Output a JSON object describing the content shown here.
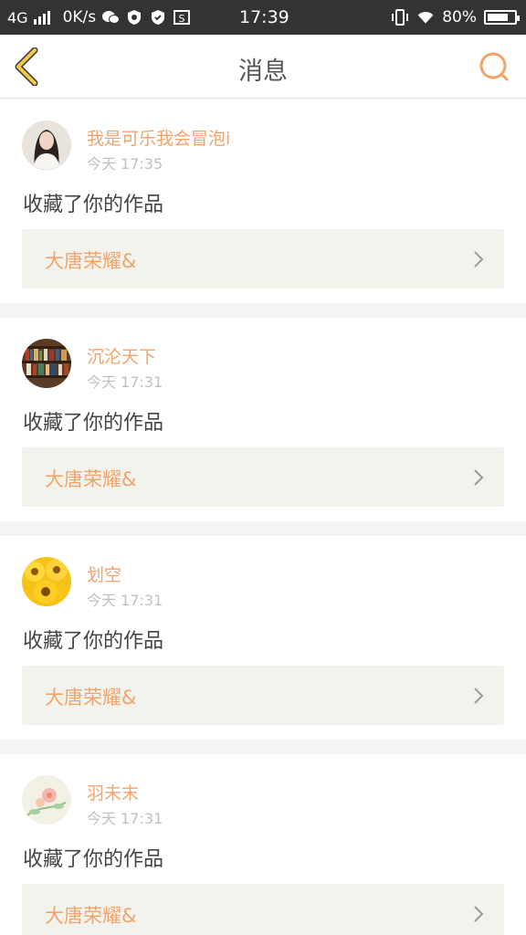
{
  "status_bar": {
    "network": "4G",
    "speed": "0K/s",
    "time": "17:39",
    "battery_text": "80%",
    "battery_level": 0.8,
    "icons": [
      "signal-icon",
      "wechat-icon",
      "shield-icon",
      "shield-check-icon",
      "s-box-icon",
      "vibrate-icon",
      "wifi-icon",
      "battery-icon"
    ]
  },
  "header": {
    "title": "消息",
    "back_icon": "chevron-left-icon",
    "search_icon": "search-icon",
    "accent_color": "#f2a36a"
  },
  "messages": [
    {
      "username": "我是可乐我会冒泡i",
      "time": "今天 17:35",
      "action": "收藏了你的作品",
      "work_title": "大唐荣耀&",
      "avatar": "woman-portrait"
    },
    {
      "username": "沉沦天下",
      "time": "今天 17:31",
      "action": "收藏了你的作品",
      "work_title": "大唐荣耀&",
      "avatar": "bookshelf"
    },
    {
      "username": "划空",
      "time": "今天 17:31",
      "action": "收藏了你的作品",
      "work_title": "大唐荣耀&",
      "avatar": "sunflowers"
    },
    {
      "username": "羽未末",
      "time": "今天 17:31",
      "action": "收藏了你的作品",
      "work_title": "大唐荣耀&",
      "avatar": "floral-art"
    }
  ]
}
